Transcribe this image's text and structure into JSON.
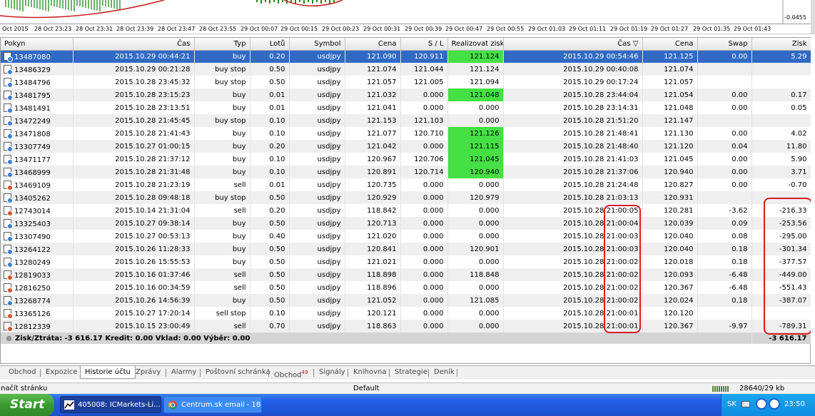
{
  "chart": {
    "price_label": "-0.0455",
    "time_labels": [
      "Oct 2015",
      "28 Oct 23:23",
      "28 Oct 23:31",
      "28 Oct 23:39",
      "28 Oct 23:47",
      "28 Oct 23:55",
      "29 Oct 00:07",
      "29 Oct 00:15",
      "29 Oct 00:23",
      "29 Oct 00:31",
      "29 Oct 00:39",
      "29 Oct 00:47",
      "29 Oct 00:55",
      "29 Oct 01:03",
      "29 Oct 01:11",
      "29 Oct 01:19",
      "29 Oct 01:27",
      "29 Oct 01:35",
      "29 Oct 01:43"
    ]
  },
  "table": {
    "headers": [
      "Pokyn",
      "Čas",
      "Typ",
      "Lotů",
      "Symbol",
      "Cena",
      "S / L",
      "Realizovat zisk",
      "Čas ▽",
      "Cena",
      "Swap",
      "Zisk"
    ],
    "rows": [
      [
        "13487080",
        "2015.10.29 00:44:21",
        "buy",
        "0.20",
        "usdjpy",
        "121.090",
        "120.911",
        "121.124",
        "2015.10.29 00:54:46",
        "121.125",
        "0.00",
        "5.29"
      ],
      [
        "13486329",
        "2015.10.29 00:21:28",
        "buy stop",
        "0.50",
        "usdjpy",
        "121.074",
        "121.044",
        "121.124",
        "2015.10.29 00:40:08",
        "121.074",
        "",
        ""
      ],
      [
        "13484796",
        "2015.10.28 23:45:32",
        "buy stop",
        "0.50",
        "usdjpy",
        "121.057",
        "121.005",
        "121.094",
        "2015.10.29 00:17:24",
        "121.057",
        "",
        ""
      ],
      [
        "13481795",
        "2015.10.28 23:15:23",
        "buy",
        "0.01",
        "usdjpy",
        "121.032",
        "0.000",
        "121.048",
        "2015.10.28 23:44:04",
        "121.054",
        "0.00",
        "0.17"
      ],
      [
        "13481491",
        "2015.10.28 23:13:51",
        "buy",
        "0.01",
        "usdjpy",
        "121.041",
        "0.000",
        "0.000",
        "2015.10.28 23:14:31",
        "121.048",
        "0.00",
        "0.05"
      ],
      [
        "13472249",
        "2015.10.28 21:45:45",
        "buy stop",
        "0.10",
        "usdjpy",
        "121.153",
        "121.103",
        "0.000",
        "2015.10.28 21:51:20",
        "121.147",
        "",
        ""
      ],
      [
        "13471808",
        "2015.10.28 21:41:43",
        "buy",
        "0.10",
        "usdjpy",
        "121.077",
        "120.710",
        "121.126",
        "2015.10.28 21:48:41",
        "121.130",
        "0.00",
        "4.02"
      ],
      [
        "13307749",
        "2015.10.27 01:00:15",
        "buy",
        "0.20",
        "usdjpy",
        "121.042",
        "0.000",
        "121.115",
        "2015.10.28 21:48:40",
        "121.120",
        "0.04",
        "11.80"
      ],
      [
        "13471177",
        "2015.10.28 21:37:12",
        "buy",
        "0.10",
        "usdjpy",
        "120.967",
        "120.706",
        "121.045",
        "2015.10.28 21:41:03",
        "121.045",
        "0.00",
        "5.90"
      ],
      [
        "13468999",
        "2015.10.28 21:31:48",
        "buy",
        "0.10",
        "usdjpy",
        "120.891",
        "120.714",
        "120.940",
        "2015.10.28 21:37:06",
        "120.940",
        "0.00",
        "3.71"
      ],
      [
        "13469109",
        "2015.10.28 21:23:19",
        "sell",
        "0.01",
        "usdjpy",
        "120.735",
        "0.000",
        "0.000",
        "2015.10.28 21:24:48",
        "120.827",
        "0.00",
        "-0.70"
      ],
      [
        "13405262",
        "2015.10.28 09:48:18",
        "buy stop",
        "0.50",
        "usdjpy",
        "120.929",
        "0.000",
        "120.979",
        "2015.10.28 21:03:13",
        "120.931",
        "",
        ""
      ],
      [
        "12743014",
        "2015.10.14 21:31:04",
        "sell",
        "0.20",
        "usdjpy",
        "118.842",
        "0.000",
        "0.000",
        "2015.10.28 21:00:05",
        "120.281",
        "-3.62",
        "-216.33"
      ],
      [
        "13325403",
        "2015.10.27 09:38:14",
        "buy",
        "0.50",
        "usdjpy",
        "120.713",
        "0.000",
        "0.000",
        "2015.10.28 21:00:04",
        "120.039",
        "0.09",
        "-253.56"
      ],
      [
        "13307490",
        "2015.10.27 00:53:13",
        "buy",
        "0.40",
        "usdjpy",
        "121.020",
        "0.000",
        "0.000",
        "2015.10.28 21:00:03",
        "120.040",
        "0.08",
        "-295.00"
      ],
      [
        "13264122",
        "2015.10.26 11:28:33",
        "buy",
        "0.50",
        "usdjpy",
        "120.841",
        "0.000",
        "120.901",
        "2015.10.28 21:00:03",
        "120.040",
        "0.18",
        "-301.34"
      ],
      [
        "13280249",
        "2015.10.26 15:55:53",
        "buy",
        "0.50",
        "usdjpy",
        "121.021",
        "0.000",
        "0.000",
        "2015.10.28 21:00:02",
        "120.018",
        "0.18",
        "-377.57"
      ],
      [
        "12819033",
        "2015.10.16 01:37:46",
        "sell",
        "0.50",
        "usdjpy",
        "118.898",
        "0.000",
        "118.848",
        "2015.10.28 21:00:02",
        "120.093",
        "-6.48",
        "-449.00"
      ],
      [
        "12816250",
        "2015.10.16 00:34:59",
        "sell",
        "0.50",
        "usdjpy",
        "118.896",
        "0.000",
        "0.000",
        "2015.10.28 21:00:02",
        "120.367",
        "-6.48",
        "-551.43"
      ],
      [
        "13268774",
        "2015.10.26 14:56:39",
        "buy",
        "0.50",
        "usdjpy",
        "121.052",
        "0.000",
        "121.085",
        "2015.10.28 21:00:02",
        "120.024",
        "0.18",
        "-387.07"
      ],
      [
        "13365126",
        "2015.10.27 17:20:14",
        "sell stop",
        "0.10",
        "usdjpy",
        "120.121",
        "0.000",
        "0.000",
        "2015.10.28 21:00:01",
        "120.120",
        "",
        ""
      ],
      [
        "12812339",
        "2015.10.15 23:00:49",
        "sell",
        "0.70",
        "usdjpy",
        "118.863",
        "0.000",
        "0.000",
        "2015.10.28 21:00:01",
        "120.367",
        "-9.97",
        "-789.31"
      ]
    ],
    "highlight_rows": [
      0,
      3,
      6,
      7,
      8,
      9
    ],
    "selected_row": 0,
    "summary": "Zisk/Ztráta: -3 616.17  Kredit: 0.00  Vklad: 0.00  Výběr: 0.00",
    "summary_total": "-3 616.17",
    "highlight_color": "#44e044",
    "annotation_color": "#d61c1c"
  },
  "tabs": [
    {
      "label": "Obchod"
    },
    {
      "label": "Expozice"
    },
    {
      "label": "Historie účtu",
      "active": true
    },
    {
      "label": "Zprávy"
    },
    {
      "label": "Alarmy"
    },
    {
      "label": "Poštovní schránka"
    },
    {
      "label": "Obchod",
      "badge": "49"
    },
    {
      "label": "Signály"
    },
    {
      "label": "Knihovna"
    },
    {
      "label": "Strategie"
    },
    {
      "label": "Deník"
    }
  ],
  "status": {
    "left": "načít stránku",
    "profile": "Default",
    "traffic": "28640/29 kb"
  },
  "taskbar": {
    "start": "Start",
    "items": [
      "405008: ICMarkets-Li...",
      "Centrum.sk email - 18..."
    ],
    "lang": "SK",
    "clock": "23:50"
  }
}
